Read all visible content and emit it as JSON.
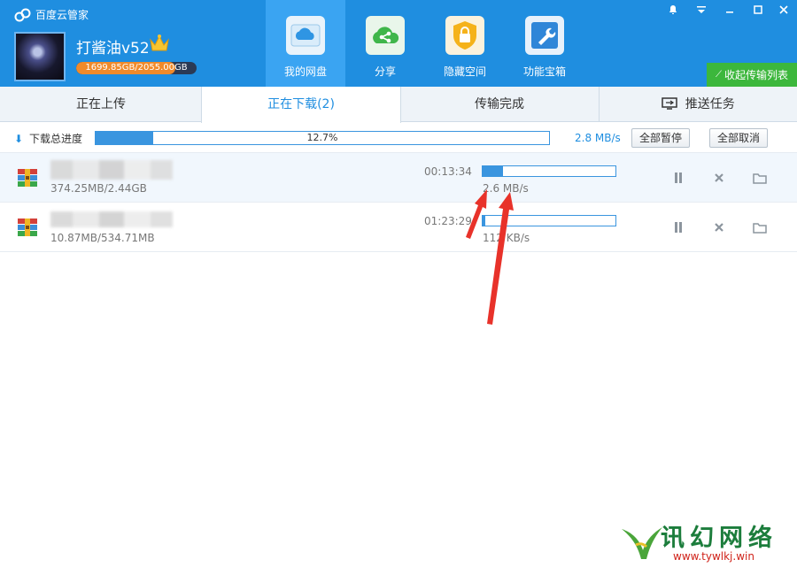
{
  "app": {
    "title": "百度云管家"
  },
  "user": {
    "name": "打酱油v52",
    "quota_text": "1699.85GB/2055.00GB",
    "quota_used_fraction": 0.827
  },
  "nav": [
    {
      "label": "我的网盘",
      "icon": "cloud-icon",
      "active": true
    },
    {
      "label": "分享",
      "icon": "share-icon",
      "active": false
    },
    {
      "label": "隐藏空间",
      "icon": "lock-icon",
      "active": false
    },
    {
      "label": "功能宝箱",
      "icon": "wrench-icon",
      "active": false
    }
  ],
  "window_controls": [
    "bell-icon",
    "menu-icon",
    "minimize-icon",
    "maximize-icon",
    "close-icon"
  ],
  "collapse_label": "收起传输列表",
  "tabs": [
    {
      "label": "正在上传",
      "active": false
    },
    {
      "label": "正在下载(2)",
      "active": true
    },
    {
      "label": "传输完成",
      "active": false
    },
    {
      "label": "推送任务",
      "active": false,
      "icon": "monitor-icon"
    }
  ],
  "summary": {
    "label": "下载总进度",
    "progress_text": "12.7%",
    "progress_fraction": 0.127,
    "speed": "2.8 MB/s",
    "pause_all": "全部暂停",
    "cancel_all": "全部取消"
  },
  "downloads": [
    {
      "size": "374.25MB/2.44GB",
      "time_left": "00:13:34",
      "progress_fraction": 0.15,
      "speed": "2.6 MB/s",
      "selected": true
    },
    {
      "size": "10.87MB/534.71MB",
      "time_left": "01:23:29",
      "progress_fraction": 0.02,
      "speed": "112 KB/s",
      "selected": false
    }
  ],
  "watermark": {
    "text": "讯幻网络",
    "url": "www.tywlkj.win"
  },
  "colors": {
    "header_blue": "#1f8ee0",
    "nav_active": "#3aa4f2",
    "progress_blue": "#3a95df",
    "collapse_green": "#3cb73c",
    "annotation_red": "#e8322a"
  }
}
